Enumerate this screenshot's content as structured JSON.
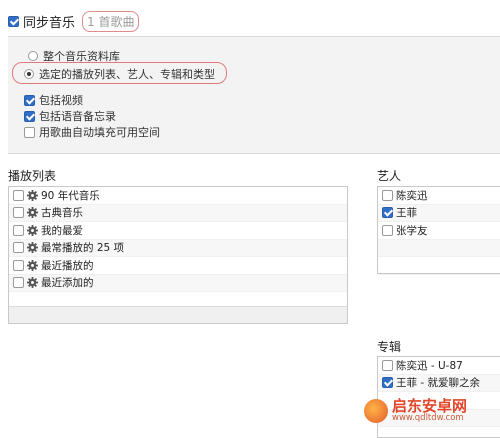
{
  "sync": {
    "label": "同步音乐",
    "count": "1 首歌曲",
    "checked": true
  },
  "options": {
    "entire_library": "整个音乐资料库",
    "selected_items": "选定的播放列表、艺人、专辑和类型",
    "include_videos": "包括视频",
    "include_voice_memos": "包括语音备忘录",
    "autofill": "用歌曲自动填充可用空间"
  },
  "playlists": {
    "title": "播放列表",
    "items": [
      {
        "label": "90 年代音乐"
      },
      {
        "label": "古典音乐"
      },
      {
        "label": "我的最爱"
      },
      {
        "label": "最常播放的 25 项"
      },
      {
        "label": "最近播放的"
      },
      {
        "label": "最近添加的"
      }
    ]
  },
  "artists": {
    "title": "艺人",
    "items": [
      {
        "label": "陈奕迅",
        "checked": false
      },
      {
        "label": "王菲",
        "checked": true
      },
      {
        "label": "张学友",
        "checked": false
      }
    ]
  },
  "albums": {
    "title": "专辑",
    "items": [
      {
        "label": "陈奕迅 - U-87",
        "checked": false
      },
      {
        "label": "王菲 - 就爱聊之余",
        "checked": true
      }
    ]
  },
  "watermark": {
    "name": "启东安卓网",
    "url": "www.qdltdw.com"
  },
  "colors": {
    "accent": "#2f6fc9",
    "highlight": "#e07b7b",
    "panel": "#f3f3f3"
  }
}
